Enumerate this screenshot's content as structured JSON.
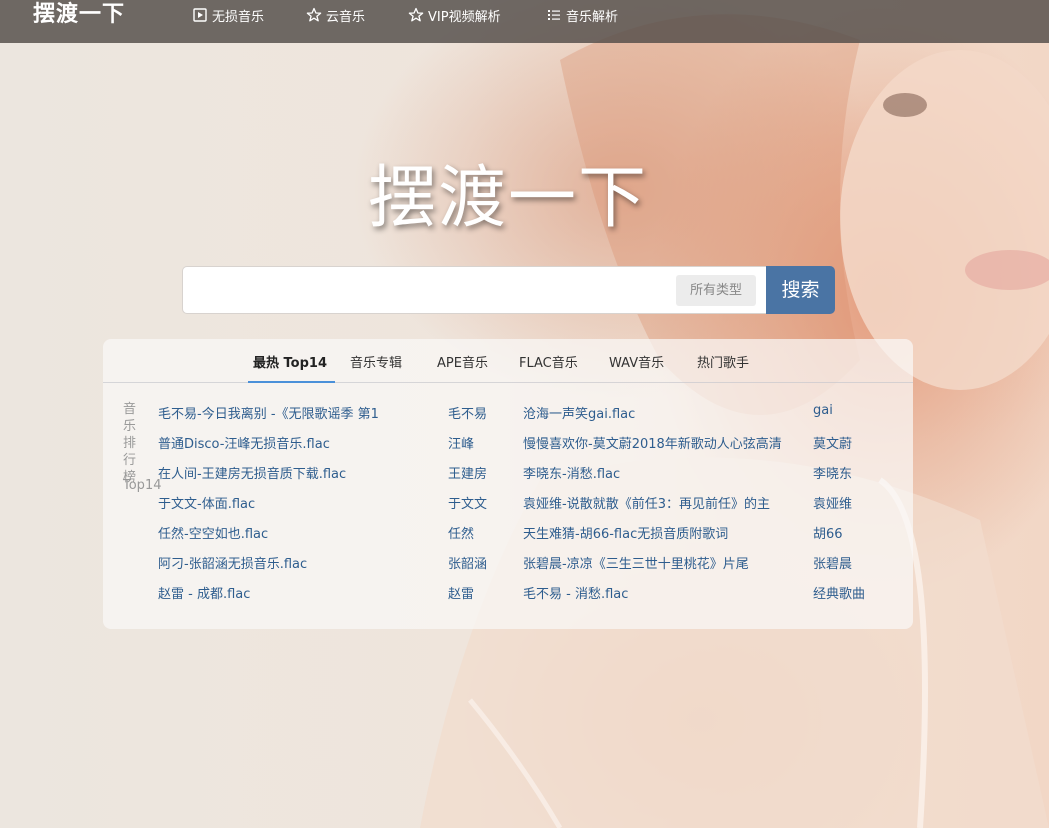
{
  "site": {
    "logo": "摆渡一下",
    "hero_title": "摆渡一下"
  },
  "nav": [
    {
      "label": "无损音乐",
      "icon": "play-square-icon"
    },
    {
      "label": "云音乐",
      "icon": "star-icon"
    },
    {
      "label": "VIP视频解析",
      "icon": "star-icon"
    },
    {
      "label": "音乐解析",
      "icon": "list-icon"
    }
  ],
  "search": {
    "placeholder": "",
    "value": "",
    "type_label": "所有类型",
    "button_label": "搜索"
  },
  "tabs": [
    {
      "label": "最热 Top14",
      "active": true
    },
    {
      "label": "音乐专辑"
    },
    {
      "label": "APE音乐"
    },
    {
      "label": "FLAC音乐"
    },
    {
      "label": "WAV音乐"
    },
    {
      "label": "热门歌手"
    }
  ],
  "ranking": {
    "label_vertical": [
      "音",
      "乐",
      "排",
      "行",
      "榜"
    ],
    "label_tail": "Top14",
    "rows": [
      {
        "song1": "毛不易-今日我离别 -《无限歌谣季 第1",
        "artist1": "毛不易",
        "song2": "沧海一声笑gai.flac",
        "artist2": "gai"
      },
      {
        "song1": "普通Disco-汪峰无损音乐.flac",
        "artist1": "汪峰",
        "song2": "慢慢喜欢你-莫文蔚2018年新歌动人心弦高清",
        "artist2": "莫文蔚"
      },
      {
        "song1": "在人间-王建房无损音质下载.flac",
        "artist1": "王建房",
        "song2": "李晓东-消愁.flac",
        "artist2": "李晓东"
      },
      {
        "song1": "于文文-体面.flac",
        "artist1": "于文文",
        "song2": "袁娅维-说散就散《前任3：再见前任》的主",
        "artist2": "袁娅维"
      },
      {
        "song1": "任然-空空如也.flac",
        "artist1": "任然",
        "song2": "天生难猜-胡66-flac无损音质附歌词",
        "artist2": "胡66"
      },
      {
        "song1": "阿刁-张韶涵无损音乐.flac",
        "artist1": "张韶涵",
        "song2": "张碧晨-凉凉《三生三世十里桃花》片尾",
        "artist2": "张碧晨"
      },
      {
        "song1": "赵雷 - 成都.flac",
        "artist1": "赵雷",
        "song2": "毛不易 - 消愁.flac",
        "artist2": "经典歌曲"
      }
    ]
  },
  "colors": {
    "topbar": "#524c48",
    "accent": "#4a74a4",
    "tab_underline": "#4a90d9",
    "link": "#2e5d8e"
  }
}
